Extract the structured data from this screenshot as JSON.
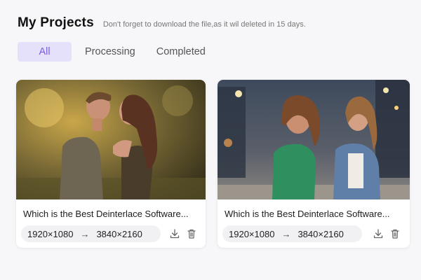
{
  "header": {
    "title": "My Projects",
    "notice": "Don't forget to download the file,as it wil deleted in 15 days."
  },
  "tabs": [
    {
      "label": "All",
      "active": true
    },
    {
      "label": "Processing",
      "active": false
    },
    {
      "label": "Completed",
      "active": false
    }
  ],
  "projects": [
    {
      "title": "Which is the Best Deinterlace Software...",
      "from_res": "1920×1080",
      "arrow": "→",
      "to_res": "3840×2160",
      "thumbnail": "couple-embracing-outdoors-photo"
    },
    {
      "title": "Which is the Best Deinterlace Software...",
      "from_res": "1920×1080",
      "arrow": "→",
      "to_res": "3840×2160",
      "thumbnail": "two-women-laughing-city-street-photo"
    }
  ],
  "icons": {
    "download": "download-icon",
    "delete": "trash-icon"
  },
  "colors": {
    "accent": "#7b5be6",
    "accent_bg": "#e6e1fb",
    "background": "#f7f7f9"
  }
}
